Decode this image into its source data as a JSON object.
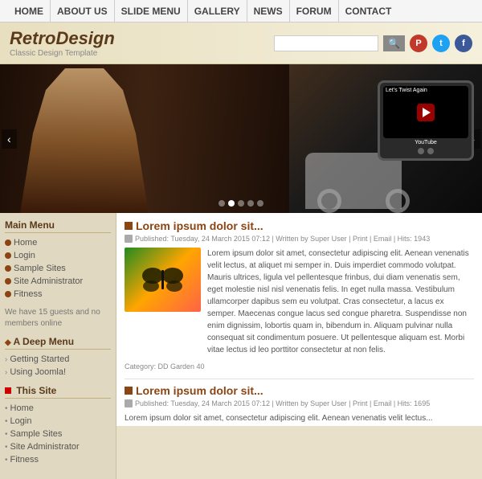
{
  "nav": {
    "items": [
      {
        "label": "HOME",
        "id": "home"
      },
      {
        "label": "ABOUT US",
        "id": "about"
      },
      {
        "label": "SLIDE MENU",
        "id": "slide-menu"
      },
      {
        "label": "GALLERY",
        "id": "gallery"
      },
      {
        "label": "NEWS",
        "id": "news"
      },
      {
        "label": "FORUM",
        "id": "forum"
      },
      {
        "label": "CONTACT",
        "id": "contact"
      }
    ]
  },
  "header": {
    "title": "RetroDesign",
    "subtitle": "Classic Design Template",
    "search_placeholder": "",
    "social": [
      {
        "label": "P",
        "class": "si-p",
        "name": "pinterest"
      },
      {
        "label": "t",
        "class": "si-t",
        "name": "twitter"
      },
      {
        "label": "f",
        "class": "si-f",
        "name": "facebook"
      }
    ]
  },
  "slideshow": {
    "tv_title": "Let's Twist Again",
    "tv_label": "YouTube",
    "dots": 5,
    "active_dot": 2
  },
  "sidebar": {
    "main_menu_title": "Main Menu",
    "main_menu_items": [
      {
        "label": "Home"
      },
      {
        "label": "Login"
      },
      {
        "label": "Sample Sites"
      },
      {
        "label": "Site Administrator"
      },
      {
        "label": "Fitness"
      }
    ],
    "guest_note": "We have 15 guests and no members online",
    "deep_menu_title": "A Deep Menu",
    "deep_menu_items": [
      {
        "label": "Getting Started"
      },
      {
        "label": "Using Joomla!"
      }
    ],
    "this_site_title": "This Site",
    "this_site_items": [
      {
        "label": "Home"
      },
      {
        "label": "Login"
      },
      {
        "label": "Sample Sites"
      },
      {
        "label": "Site Administrator"
      },
      {
        "label": "Fitness"
      }
    ]
  },
  "articles": [
    {
      "title": "Lorem ipsum dolor sit...",
      "meta": "Published: Tuesday, 24 March 2015 07:12 | Written by Super User | Print | Email | Hits: 1943",
      "text": "Lorem ipsum dolor sit amet, consectetur adipiscing elit. Aenean venenatis velit lectus, at aliquet mi semper in. Duis imperdiet commodo volutpat. Mauris ultrices, ligula vel pellentesque frinbus, dui diam venenatis sem, eget molestie nisl nisl venenatis felis. In eget nulla massa. Vestibulum ullamcorper dapibus sem eu volutpat. Cras consectetur, a lacus ex semper. Maecenas congue lacus sed congue pharetra. Suspendisse non enim dignissim, lobortis quam in, bibendum in. Aliquam pulvinar nulla consequat sit condimentum posuere. Ut pellentesque aliquam est. Morbi vitae lectus id leo porttitor consectetur at non felis.",
      "thumb_caption": "Category: DD Garden 40",
      "id": 1
    },
    {
      "title": "Lorem ipsum dolor sit...",
      "meta": "Published: Tuesday, 24 March 2015 07:12 | Written by Super User | Print | Email | Hits: 1695",
      "text": "Lorem ipsum dolor sit amet, consectetur adipiscing elit. Aenean venenatis velit lectus...",
      "id": 2
    }
  ]
}
